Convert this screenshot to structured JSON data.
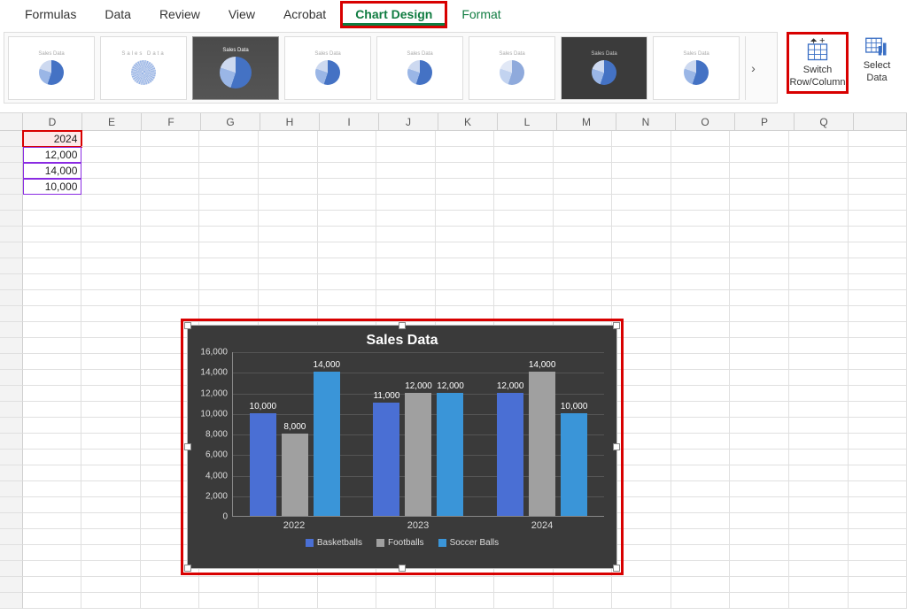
{
  "ribbon": {
    "tabs": [
      "Formulas",
      "Data",
      "Review",
      "View",
      "Acrobat",
      "Chart Design",
      "Format"
    ],
    "active_tab": "Chart Design",
    "style_thumb_label": "Sales Data",
    "switch_label1": "Switch",
    "switch_label2": "Row/Column",
    "select_label1": "Select",
    "select_label2": "Data"
  },
  "columns": [
    "D",
    "E",
    "F",
    "G",
    "H",
    "I",
    "J",
    "K",
    "L",
    "M",
    "N",
    "O",
    "P",
    "Q"
  ],
  "visible_cells": {
    "r1": "2024",
    "r2": "12,000",
    "r3": "14,000",
    "r4": "10,000"
  },
  "chart_data": {
    "type": "bar",
    "title": "Sales Data",
    "categories": [
      "2022",
      "2023",
      "2024"
    ],
    "series": [
      {
        "name": "Basketballs",
        "color": "#4a6fd4",
        "values": [
          10000,
          11000,
          12000
        ]
      },
      {
        "name": "Footballs",
        "color": "#a0a0a0",
        "values": [
          8000,
          12000,
          14000
        ]
      },
      {
        "name": "Soccer Balls",
        "color": "#3a95d8",
        "values": [
          14000,
          12000,
          10000
        ]
      }
    ],
    "y_ticks": [
      0,
      2000,
      4000,
      6000,
      8000,
      10000,
      12000,
      14000,
      16000
    ],
    "y_tick_labels": [
      "0",
      "2,000",
      "4,000",
      "6,000",
      "8,000",
      "10,000",
      "12,000",
      "14,000",
      "16,000"
    ],
    "ymax": 16000,
    "data_labels": [
      [
        "10,000",
        "8,000",
        "14,000"
      ],
      [
        "11,000",
        "12,000",
        "12,000"
      ],
      [
        "12,000",
        "14,000",
        "10,000"
      ]
    ]
  }
}
